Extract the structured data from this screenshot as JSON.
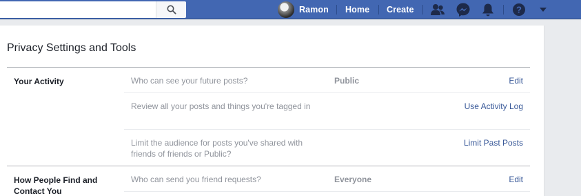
{
  "header": {
    "search_placeholder": "",
    "user_name": "Ramon",
    "home_label": "Home",
    "create_label": "Create",
    "icons": [
      "search-icon",
      "friends-icon",
      "messenger-icon",
      "notifications-icon",
      "help-icon",
      "menu-caret-icon"
    ]
  },
  "page": {
    "title": "Privacy Settings and Tools"
  },
  "sections": [
    {
      "title": "Your Activity",
      "rows": [
        {
          "description": "Who can see your future posts?",
          "value": "Public",
          "action": "Edit"
        },
        {
          "description": "Review all your posts and things you're tagged in",
          "value": "",
          "action": "Use Activity Log"
        },
        {
          "description": "Limit the audience for posts you've shared with friends of friends or Public?",
          "value": "",
          "action": "Limit Past Posts"
        }
      ]
    },
    {
      "title": "How People Find and Contact You",
      "rows": [
        {
          "description": "Who can send you friend requests?",
          "value": "Everyone",
          "action": "Edit"
        }
      ]
    }
  ],
  "colors": {
    "topbar": "#4267b2",
    "link": "#385898",
    "muted_text": "#90949c",
    "background": "#e9ebee"
  }
}
